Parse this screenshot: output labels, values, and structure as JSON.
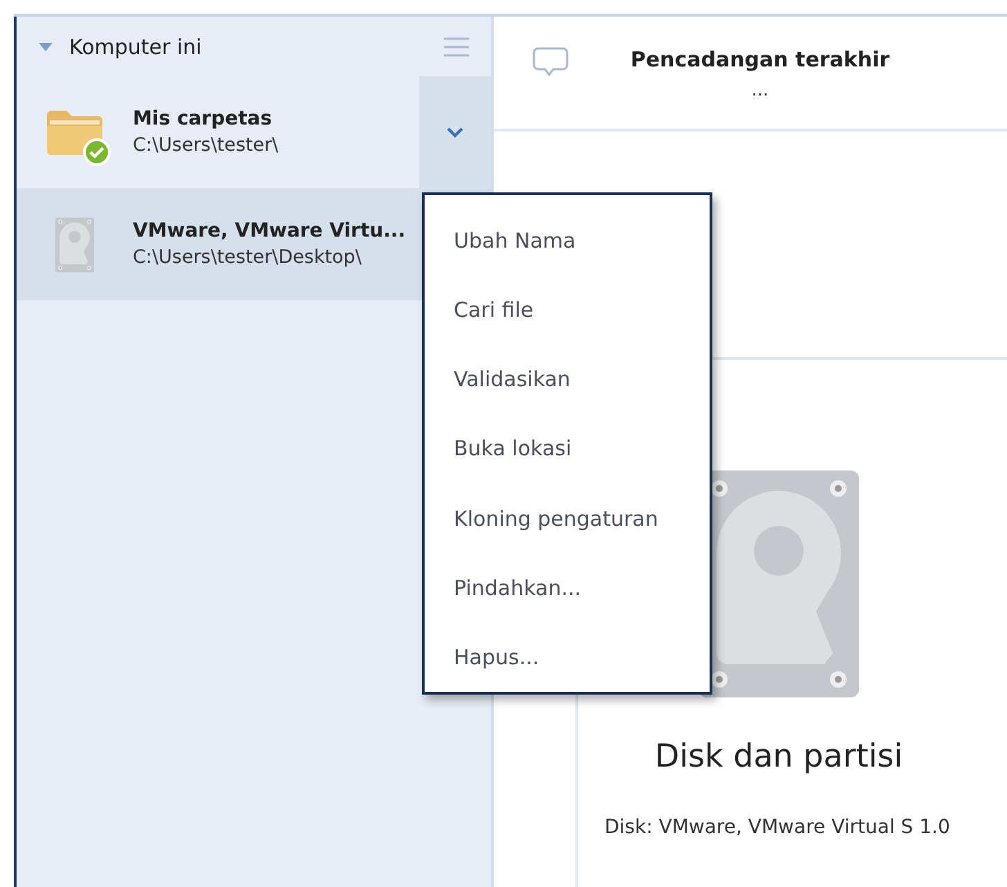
{
  "sidebar": {
    "section": {
      "label": "Komputer ini",
      "expanded": true
    },
    "items": [
      {
        "kind": "folder",
        "name": "Mis carpetas",
        "path": "C:\\Users\\tester\\",
        "selected": false,
        "backed_up": true,
        "menu_button": true
      },
      {
        "kind": "disk",
        "name": "VMware, VMware Virtu...",
        "path": "C:\\Users\\tester\\Desktop\\",
        "selected": true,
        "backed_up": false,
        "menu_button": false
      }
    ]
  },
  "context_menu": {
    "items": [
      "Ubah Nama",
      "Cari file",
      "Validasikan",
      "Buka lokasi",
      "Kloning pengaturan",
      "Pindahkan...",
      "Hapus..."
    ]
  },
  "main": {
    "last_backup": {
      "label": "Pencadangan terakhir",
      "value": "..."
    },
    "card": {
      "title": "Disk dan partisi",
      "description": "Disk: VMware, VMware Virtual S 1.0"
    }
  }
}
